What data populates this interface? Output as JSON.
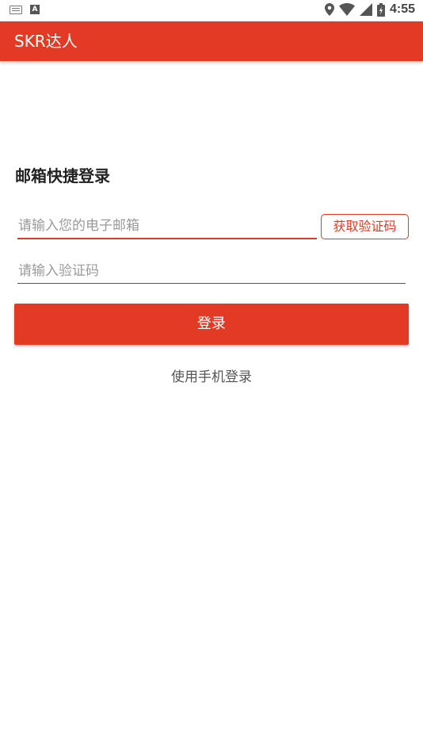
{
  "status_bar": {
    "time": "4:55",
    "left_icons": [
      "keyboard-icon",
      "text-a-icon"
    ],
    "right_icons": [
      "location-icon",
      "wifi-icon",
      "signal-icon",
      "battery-icon"
    ]
  },
  "app_bar": {
    "title": "SKR达人",
    "color": "#e23a24"
  },
  "login_form": {
    "heading": "邮箱快捷登录",
    "email_placeholder": "请输入您的电子邮箱",
    "code_placeholder": "请输入验证码",
    "get_code_label": "获取验证码",
    "login_label": "登录",
    "phone_login_label": "使用手机登录"
  }
}
